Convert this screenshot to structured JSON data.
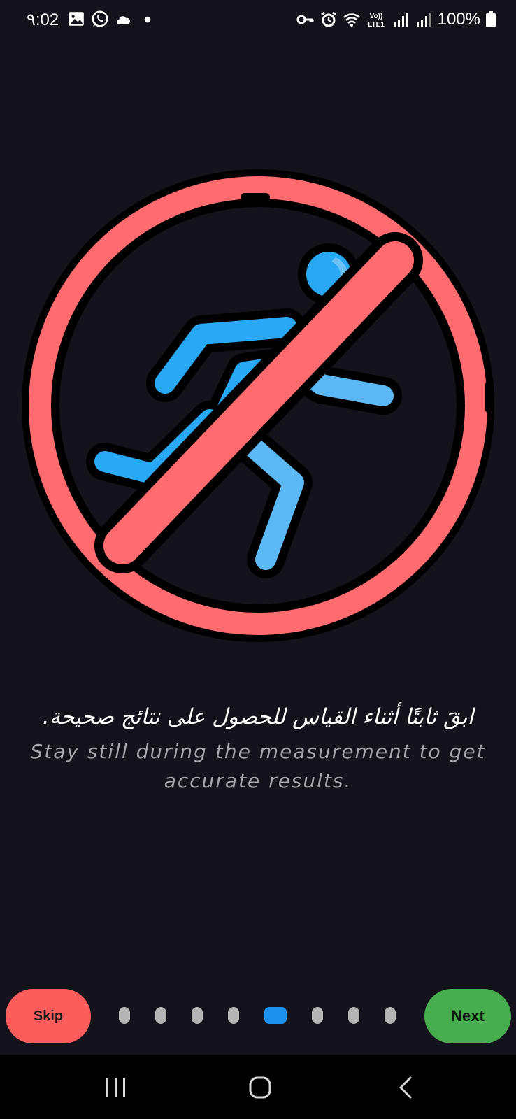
{
  "status_bar": {
    "time": "٩:02",
    "battery": "100%",
    "left_icons": [
      "gallery-icon",
      "whatsapp-icon",
      "cloud-icon",
      "dot-icon"
    ],
    "right_icons": [
      "key-icon",
      "alarm-icon",
      "wifi-icon",
      "volte-icon",
      "signal-icon",
      "signal-icon",
      "battery-icon"
    ],
    "volte_label_top": "Vo))",
    "volte_label_bottom": "LTE1"
  },
  "illustration": {
    "icon": "no-running-icon",
    "colors": {
      "ring": "#ff6b6e",
      "figure": "#29a8f5",
      "outline": "#000000"
    }
  },
  "instruction": {
    "arabic": "ابقَ ثابتًا أثناء القياس للحصول على نتائج صحيحة.",
    "english": "Stay still during the measurement to get accurate results."
  },
  "controls": {
    "skip_label": "Skip",
    "next_label": "Next",
    "page_count": 8,
    "active_page": 5
  },
  "nav_bar": {
    "icons": [
      "recent-apps-icon",
      "home-icon",
      "back-icon"
    ]
  }
}
